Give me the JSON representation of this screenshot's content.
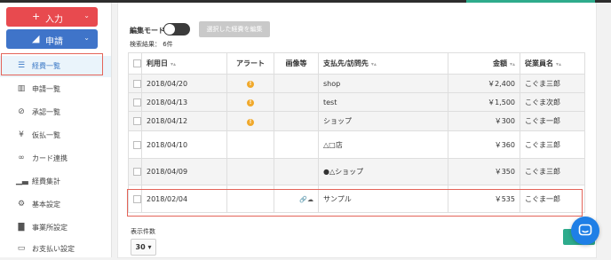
{
  "sidebar": {
    "input_button": {
      "icon": "+",
      "label": "入力",
      "caret": "⌄"
    },
    "apply_button": {
      "icon": "◢",
      "label": "申請",
      "caret": "⌄"
    },
    "items": [
      {
        "icon": "☰",
        "label": "経費一覧",
        "active": true
      },
      {
        "icon": "▥",
        "label": "申請一覧"
      },
      {
        "icon": "⊘",
        "label": "承認一覧"
      },
      {
        "icon": "¥",
        "label": "仮払一覧"
      },
      {
        "icon": "∞",
        "label": "カード連携"
      },
      {
        "icon": "▁▃",
        "label": "経費集計"
      },
      {
        "icon": "⚙",
        "label": "基本設定"
      },
      {
        "icon": "▇",
        "label": "事業所設定"
      },
      {
        "icon": "▭",
        "label": "お支払い設定"
      }
    ]
  },
  "toolbar": {
    "edit_mode_label": "編集モード",
    "edit_button_label": "選択した経費を編集",
    "result_count": "検索結果： 6件"
  },
  "table": {
    "sort_glyph": "▾▴",
    "headers": {
      "date": "利用日",
      "alert": "アラート",
      "image": "画像等",
      "payee": "支払先/訪問先",
      "amount": "金額",
      "employee": "従業員名"
    },
    "rows": [
      {
        "date": "2018/04/20",
        "alert": "!",
        "image": "",
        "payee": "shop",
        "amount": "￥2,400",
        "employee": "こぐま三郎"
      },
      {
        "date": "2018/04/13",
        "alert": "!",
        "image": "",
        "payee": "test",
        "amount": "￥1,500",
        "employee": "こぐま次郎"
      },
      {
        "date": "2018/04/12",
        "alert": "!",
        "image": "",
        "payee": "ショップ",
        "amount": "￥300",
        "employee": "こぐま一郎"
      },
      {
        "date": "2018/04/10",
        "alert": "",
        "image": "",
        "payee": "△□店",
        "amount": "￥360",
        "employee": "こぐま三郎"
      },
      {
        "date": "2018/04/09",
        "alert": "",
        "image": "",
        "payee": "●△ショップ",
        "amount": "￥350",
        "employee": "こぐま三郎"
      },
      {
        "date": "2018/02/04",
        "alert": "",
        "image": "🔗☁",
        "payee": "サンプル",
        "amount": "￥535",
        "employee": "こぐま一郎"
      }
    ]
  },
  "pagination": {
    "per_page_label": "表示件数",
    "per_page_value": "30 ▾"
  },
  "colors": {
    "input_button": "#e84a4f",
    "apply_button": "#3f74c9",
    "highlight": "#e46459",
    "alert": "#f0a92c",
    "chat": "#1f7fe6"
  }
}
